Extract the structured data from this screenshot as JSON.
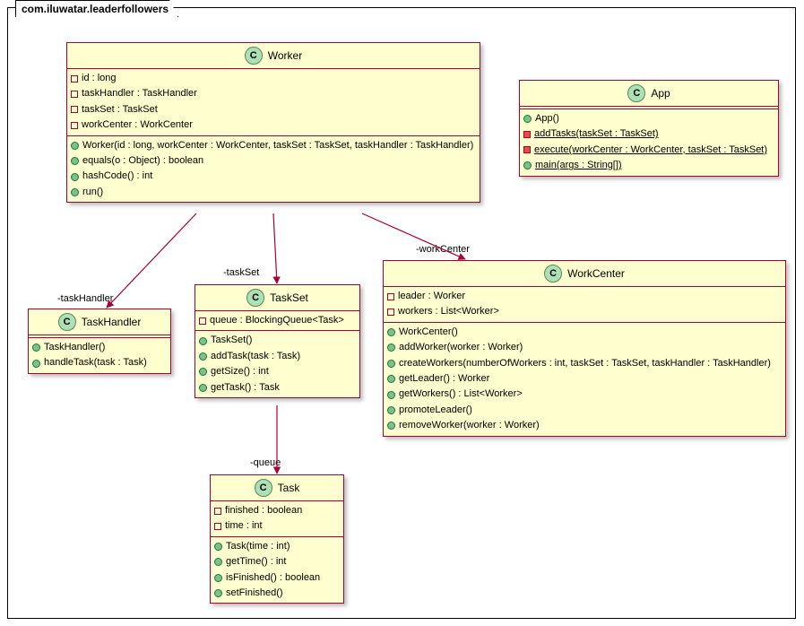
{
  "package_name": "com.iluwatar.leaderfollowers",
  "classes": {
    "worker": {
      "name": "Worker",
      "fields": [
        {
          "vis": "private",
          "text": "id : long"
        },
        {
          "vis": "private",
          "text": "taskHandler : TaskHandler"
        },
        {
          "vis": "private",
          "text": "taskSet : TaskSet"
        },
        {
          "vis": "private",
          "text": "workCenter : WorkCenter"
        }
      ],
      "methods": [
        {
          "vis": "public",
          "text": "Worker(id : long, workCenter : WorkCenter, taskSet : TaskSet, taskHandler : TaskHandler)"
        },
        {
          "vis": "public",
          "text": "equals(o : Object) : boolean"
        },
        {
          "vis": "public",
          "text": "hashCode() : int"
        },
        {
          "vis": "public",
          "text": "run()"
        }
      ]
    },
    "app": {
      "name": "App",
      "fields": [],
      "methods": [
        {
          "vis": "public",
          "text": "App()"
        },
        {
          "vis": "private-static",
          "text": "addTasks(taskSet : TaskSet)",
          "underline": true
        },
        {
          "vis": "private-static",
          "text": "execute(workCenter : WorkCenter, taskSet : TaskSet)",
          "underline": true
        },
        {
          "vis": "public",
          "text": "main(args : String[])",
          "underline": true
        }
      ]
    },
    "taskhandler": {
      "name": "TaskHandler",
      "fields": [],
      "methods": [
        {
          "vis": "public",
          "text": "TaskHandler()"
        },
        {
          "vis": "public",
          "text": "handleTask(task : Task)"
        }
      ]
    },
    "taskset": {
      "name": "TaskSet",
      "fields": [
        {
          "vis": "private",
          "text": "queue : BlockingQueue<Task>"
        }
      ],
      "methods": [
        {
          "vis": "public",
          "text": "TaskSet()"
        },
        {
          "vis": "public",
          "text": "addTask(task : Task)"
        },
        {
          "vis": "public",
          "text": "getSize() : int"
        },
        {
          "vis": "public",
          "text": "getTask() : Task"
        }
      ]
    },
    "workcenter": {
      "name": "WorkCenter",
      "fields": [
        {
          "vis": "private",
          "text": "leader : Worker"
        },
        {
          "vis": "private",
          "text": "workers : List<Worker>"
        }
      ],
      "methods": [
        {
          "vis": "public",
          "text": "WorkCenter()"
        },
        {
          "vis": "public",
          "text": "addWorker(worker : Worker)"
        },
        {
          "vis": "public",
          "text": "createWorkers(numberOfWorkers : int, taskSet : TaskSet, taskHandler : TaskHandler)"
        },
        {
          "vis": "public",
          "text": "getLeader() : Worker"
        },
        {
          "vis": "public",
          "text": "getWorkers() : List<Worker>"
        },
        {
          "vis": "public",
          "text": "promoteLeader()"
        },
        {
          "vis": "public",
          "text": "removeWorker(worker : Worker)"
        }
      ]
    },
    "task": {
      "name": "Task",
      "fields": [
        {
          "vis": "private",
          "text": "finished : boolean"
        },
        {
          "vis": "private",
          "text": "time : int"
        }
      ],
      "methods": [
        {
          "vis": "public",
          "text": "Task(time : int)"
        },
        {
          "vis": "public",
          "text": "getTime() : int"
        },
        {
          "vis": "public",
          "text": "isFinished() : boolean"
        },
        {
          "vis": "public",
          "text": "setFinished()"
        }
      ]
    }
  },
  "relations": {
    "taskHandler": "-taskHandler",
    "taskSet": "-taskSet",
    "workCenter": "-workCenter",
    "queue": "-queue"
  }
}
